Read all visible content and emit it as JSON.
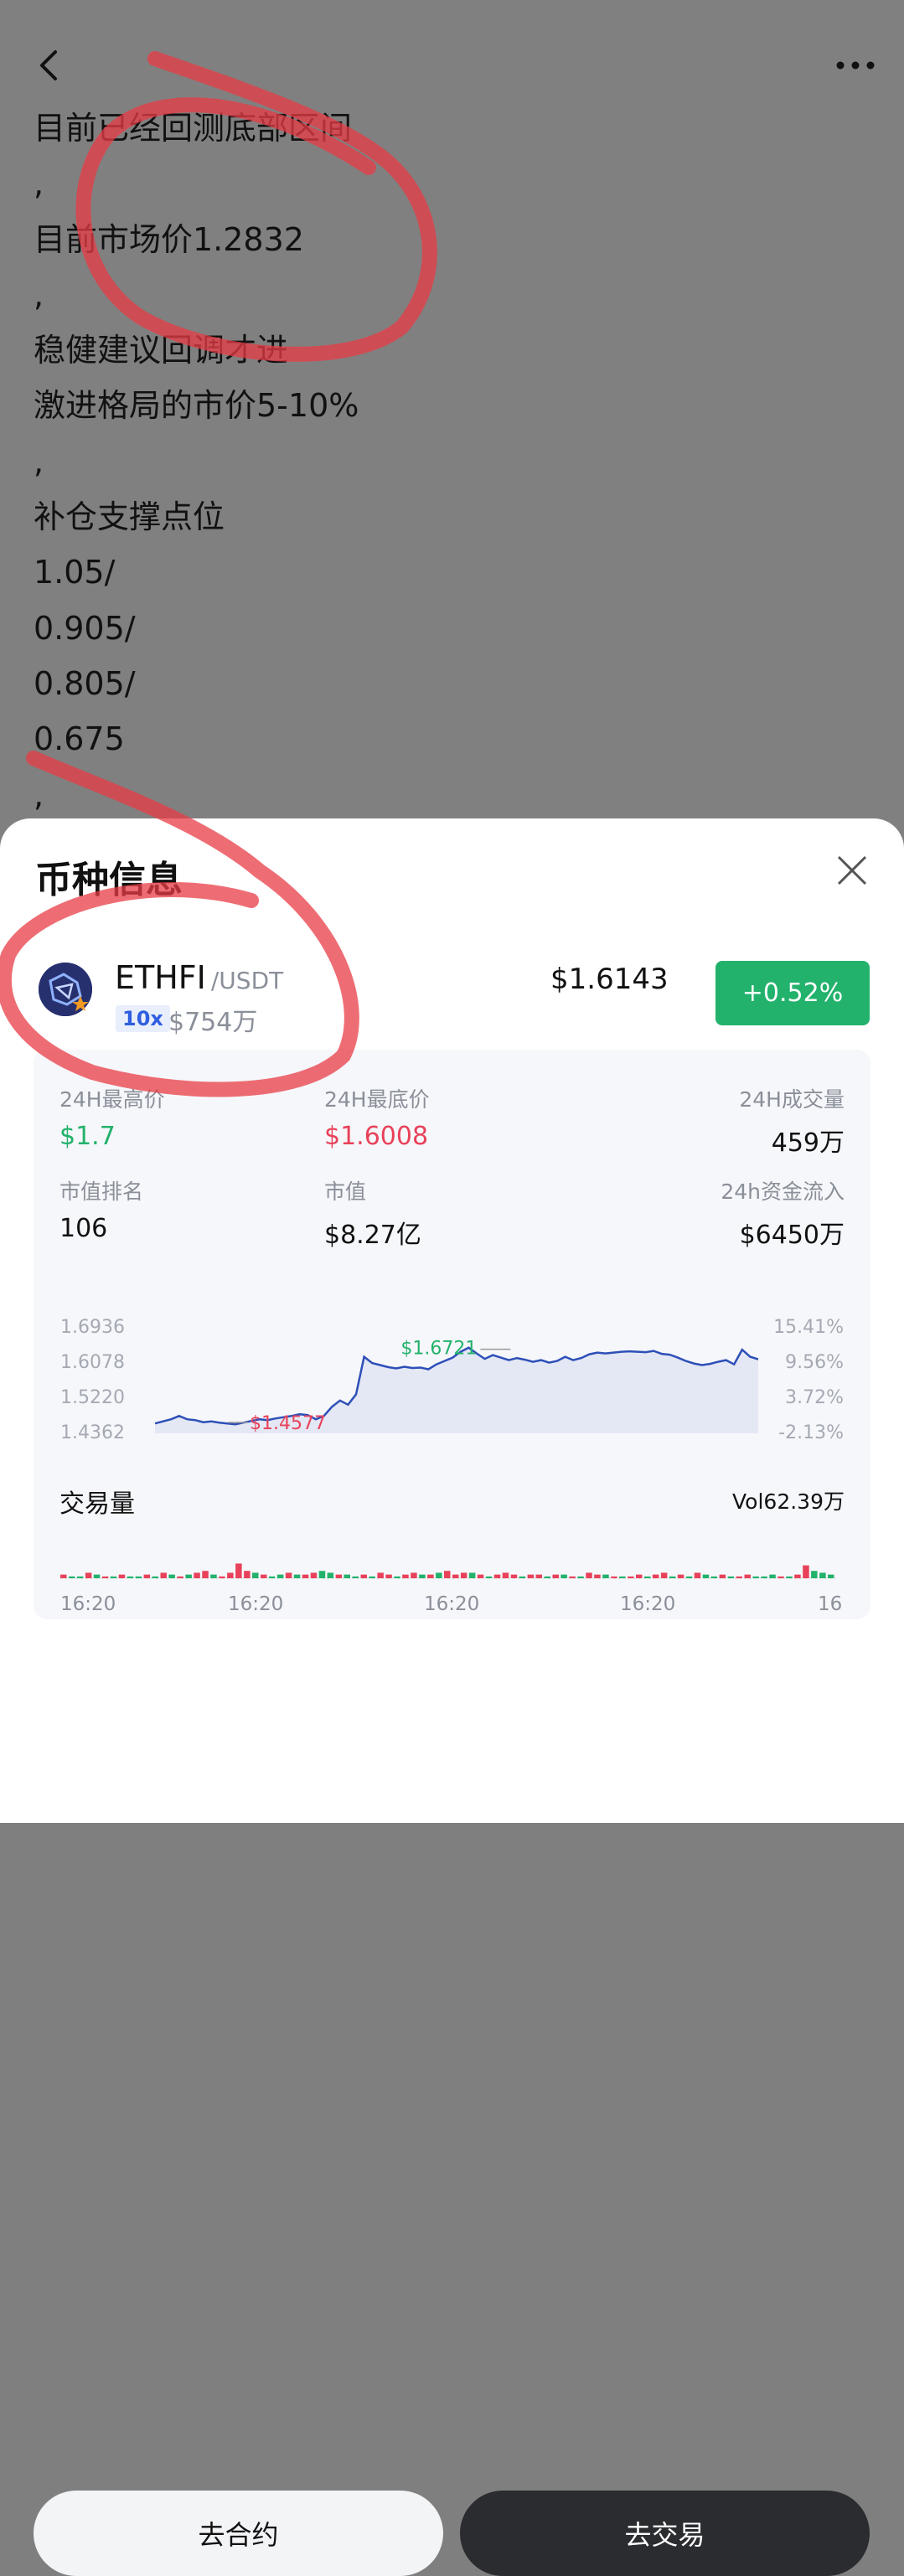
{
  "post_lines": [
    "目前已经回测底部区间",
    ",",
    "目前市场价1.2832",
    ",",
    "稳健建议回调才进",
    "激进格局的市价5-10%",
    ",",
    "补仓支撑点位",
    "1.05/",
    "0.905/",
    "0.805/",
    "0.675",
    ","
  ],
  "sheet": {
    "title": "币种信息",
    "coin": "ETHFI",
    "pair": "/USDT",
    "leverage": "10x",
    "market_cap_short": "$754万",
    "price": "$1.6143",
    "change": "+0.52%",
    "change_color": "#22b26b"
  },
  "stats": {
    "high_label": "24H最高价",
    "high_value": "$1.7",
    "low_label": "24H最底价",
    "low_value": "$1.6008",
    "volume_label": "24H成交量",
    "volume_value": "459万",
    "rank_label": "市值排名",
    "rank_value": "106",
    "mcap_label": "市值",
    "mcap_value": "$8.27亿",
    "inflow_label": "24h资金流入",
    "inflow_value": "$6450万"
  },
  "chart_data": {
    "type": "line",
    "y_ticks_left": [
      "1.6936",
      "1.6078",
      "1.5220",
      "1.4362"
    ],
    "y_ticks_right": [
      "15.41%",
      "9.56%",
      "3.72%",
      "-2.13%"
    ],
    "ylim": [
      1.4362,
      1.6936
    ],
    "series": [
      {
        "values": [
          1.46,
          1.465,
          1.47,
          1.478,
          1.47,
          1.468,
          1.463,
          1.465,
          1.462,
          1.46,
          1.458,
          1.462,
          1.466,
          1.47,
          1.468,
          1.472,
          1.475,
          1.478,
          1.482,
          1.48,
          1.47,
          1.478,
          1.5,
          1.515,
          1.505,
          1.53,
          1.62,
          1.605,
          1.6,
          1.595,
          1.592,
          1.596,
          1.593,
          1.594,
          1.59,
          1.602,
          1.61,
          1.618,
          1.632,
          1.642,
          1.628,
          1.615,
          1.624,
          1.618,
          1.612,
          1.617,
          1.613,
          1.608,
          1.612,
          1.606,
          1.61,
          1.62,
          1.612,
          1.617,
          1.626,
          1.63,
          1.628,
          1.63,
          1.632,
          1.633,
          1.632,
          1.631,
          1.634,
          1.627,
          1.625,
          1.618,
          1.61,
          1.604,
          1.6,
          1.603,
          1.608,
          1.612,
          1.602,
          1.637,
          1.62,
          1.614
        ]
      }
    ],
    "max_label": "$1.6721",
    "min_label": "$1.4577",
    "volume_title": "交易量",
    "volume_value": "Vol62.39万",
    "volume_bars": [
      2,
      1,
      1,
      3,
      2,
      1,
      1,
      2,
      1,
      1,
      2,
      1,
      3,
      2,
      1,
      2,
      3,
      4,
      2,
      1,
      3,
      8,
      4,
      3,
      2,
      1,
      2,
      3,
      2,
      2,
      3,
      4,
      3,
      2,
      2,
      1,
      2,
      1,
      3,
      2,
      1,
      2,
      3,
      2,
      2,
      3,
      4,
      2,
      3,
      3,
      2,
      1,
      2,
      3,
      2,
      1,
      2,
      2,
      1,
      2,
      2,
      1,
      1,
      3,
      2,
      2,
      1,
      1,
      1,
      2,
      1,
      2,
      3,
      1,
      2,
      1,
      3,
      2,
      1,
      2,
      1,
      1,
      2,
      1,
      1,
      2,
      1,
      1,
      2,
      7,
      4,
      3,
      2
    ],
    "volume_up": [
      0,
      1,
      1,
      0,
      1,
      0,
      1,
      0,
      1,
      1,
      0,
      1,
      0,
      1,
      0,
      1,
      0,
      0,
      1,
      0,
      0,
      0,
      0,
      1,
      0,
      1,
      1,
      0,
      1,
      0,
      0,
      1,
      1,
      0,
      1,
      1,
      0,
      1,
      0,
      0,
      1,
      0,
      0,
      1,
      0,
      1,
      0,
      0,
      0,
      1,
      0,
      1,
      0,
      0,
      0,
      1,
      0,
      0,
      1,
      0,
      1,
      0,
      1,
      0,
      0,
      1,
      0,
      1,
      0,
      0,
      1,
      0,
      0,
      1,
      0,
      1,
      0,
      1,
      1,
      0,
      1,
      0,
      0,
      1,
      1,
      1,
      0,
      1,
      0,
      0,
      1,
      1,
      1
    ],
    "x_ticks": [
      "16:20",
      "16:20",
      "16:20",
      "16:20",
      "16"
    ]
  },
  "buttons": {
    "contract": "去合约",
    "trade": "去交易"
  }
}
